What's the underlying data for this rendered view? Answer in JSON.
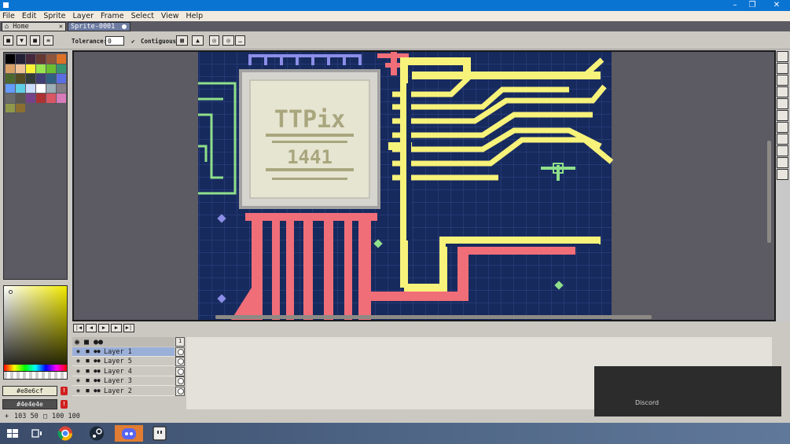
{
  "window": {
    "title": ""
  },
  "menu": [
    "File",
    "Edit",
    "Sprite",
    "Layer",
    "Frame",
    "Select",
    "View",
    "Help"
  ],
  "tabs": [
    {
      "label": "Home"
    },
    {
      "label": "Sprite-0001"
    }
  ],
  "toolbar": {
    "tolerance_label": "Tolerance:",
    "tolerance_value": "0",
    "contiguous_label": "Contiguous"
  },
  "palette": {
    "colors": [
      "#000000",
      "#222034",
      "#45283c",
      "#663931",
      "#8f563b",
      "#df7126",
      "#d9a066",
      "#eec39a",
      "#fbf236",
      "#99e550",
      "#6abe30",
      "#37946e",
      "#4b692f",
      "#524b24",
      "#323c39",
      "#3f3f74",
      "#306082",
      "#5b6ee1",
      "#639bff",
      "#5fcde4",
      "#cbdbfc",
      "#ffffff",
      "#9badb7",
      "#847e87",
      "#696a6a",
      "#595652",
      "#76428a",
      "#ac3232",
      "#d95763",
      "#d77bba",
      "#8f974a",
      "#8a6f30"
    ]
  },
  "colors": {
    "foreground_hex": "#e8e6cf",
    "background_hex": "#4e4e4e"
  },
  "layers": [
    {
      "name": "",
      "header": true
    },
    {
      "name": "Layer 1",
      "selected": true
    },
    {
      "name": "Layer 5"
    },
    {
      "name": "Layer 4"
    },
    {
      "name": "Layer 3"
    },
    {
      "name": "Layer 2"
    }
  ],
  "frame_header": "1",
  "status": {
    "coords": "103 50",
    "size": "100 100"
  },
  "canvas_art": {
    "chip_line1": "TTPix",
    "chip_line2": "1441"
  },
  "notification": {
    "label": "Discord"
  },
  "taskbar": {
    "icons": [
      "windows-start-icon",
      "task-view-icon",
      "chrome-icon",
      "steam-icon",
      "discord-icon",
      "aseprite-icon"
    ]
  }
}
